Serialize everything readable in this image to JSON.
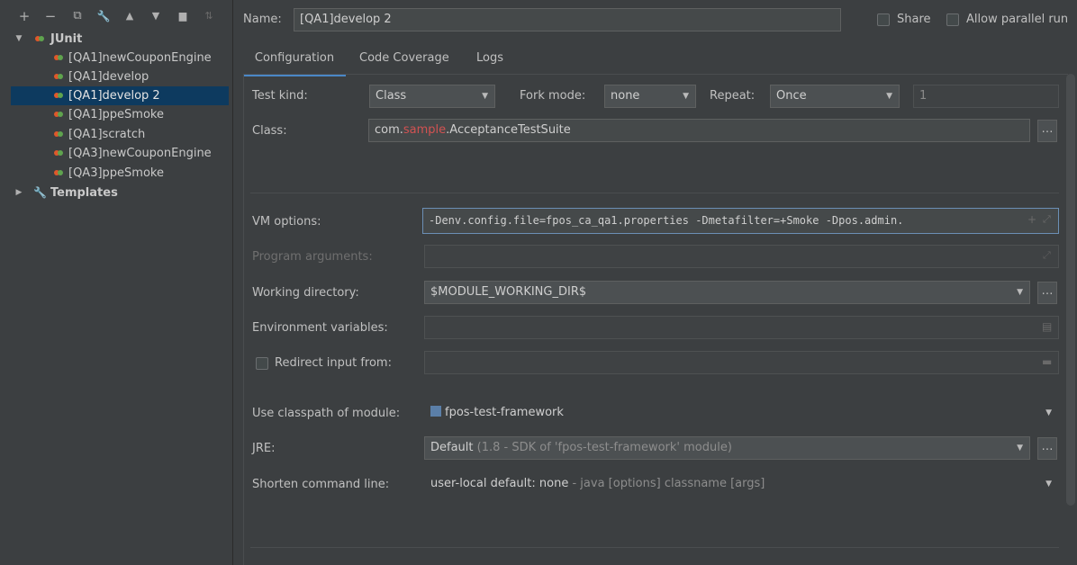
{
  "toolbar": {
    "icons": [
      "add-icon",
      "remove-icon",
      "copy-icon",
      "wrench-icon",
      "move-up-icon",
      "move-down-icon",
      "folder-icon",
      "sort-icon"
    ],
    "glyphs": [
      "+",
      "−",
      "⧉",
      "🔧",
      "▲",
      "▼",
      "▆",
      "⇅"
    ]
  },
  "tree": {
    "junit_label": "JUnit",
    "items": [
      {
        "label": "[QA1]newCouponEngine"
      },
      {
        "label": "[QA1]develop"
      },
      {
        "label": "[QA1]develop 2"
      },
      {
        "label": "[QA1]ppeSmoke"
      },
      {
        "label": "[QA1]scratch"
      },
      {
        "label": "[QA3]newCouponEngine"
      },
      {
        "label": "[QA3]ppeSmoke"
      }
    ],
    "templates_label": "Templates"
  },
  "header": {
    "name_label": "Name:",
    "name_value": "[QA1]develop 2",
    "share_label": "Share",
    "parallel_label": "Allow parallel run"
  },
  "tabs": [
    "Configuration",
    "Code Coverage",
    "Logs"
  ],
  "form": {
    "test_kind_label": "Test kind:",
    "test_kind_value": "Class",
    "fork_mode_label": "Fork mode:",
    "fork_mode_value": "none",
    "repeat_label": "Repeat:",
    "repeat_value": "Once",
    "repeat_count": "1",
    "class_label": "Class:",
    "class_value_prefix": "com.",
    "class_value_redacted": "sample",
    "class_value_suffix": ".AcceptanceTestSuite",
    "vm_label": "VM options:",
    "vm_value": "-Denv.config.file=fpos_ca_qa1.properties -Dmetafilter=+Smoke -Dpos.admin.",
    "program_args_label": "Program arguments:",
    "working_dir_label": "Working directory:",
    "working_dir_value": "$MODULE_WORKING_DIR$",
    "env_label": "Environment variables:",
    "redirect_label": "Redirect input from:",
    "classpath_label": "Use classpath of module:",
    "classpath_value": "fpos-test-framework",
    "jre_label": "JRE:",
    "jre_value_bold": "Default",
    "jre_value_detail": "(1.8 - SDK of 'fpos-test-framework' module)",
    "shorten_label": "Shorten command line:",
    "shorten_value_bold": "user-local default: none",
    "shorten_value_detail": "- java [options] classname [args]"
  }
}
